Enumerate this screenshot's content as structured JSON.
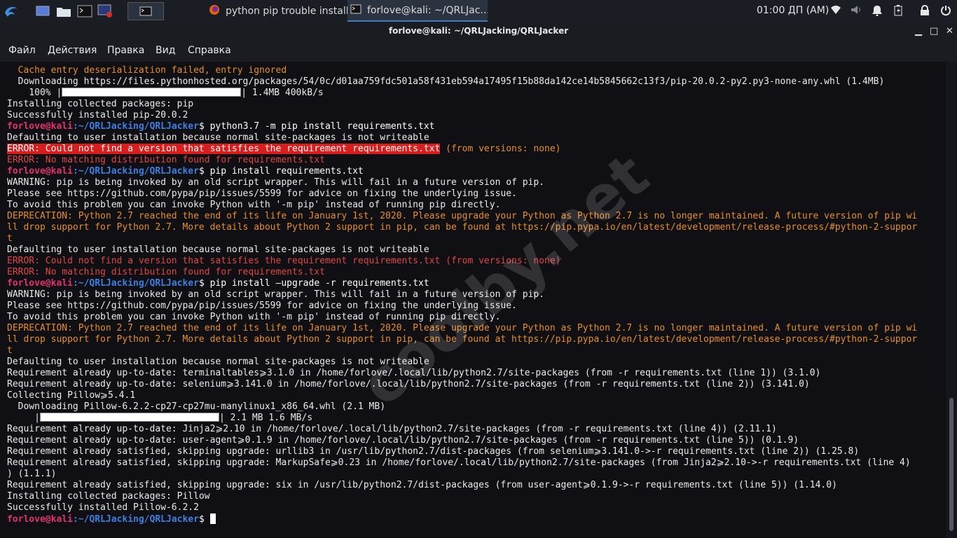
{
  "taskbar": {
    "tasks": [
      {
        "label": "python pip trouble install..."
      },
      {
        "label": "forlove@kali: ~/QRLJac..."
      }
    ],
    "clock": "01:00 ДП (AM)"
  },
  "window": {
    "title": "forlove@kali: ~/QRLJacking/QRLJacker"
  },
  "menu": [
    "Файл",
    "Действия",
    "Правка",
    "Вид",
    "Справка"
  ],
  "prompt": {
    "user": "forlove",
    "at": "@",
    "host": "kali",
    "path": ":~/QRLJacking/QRLJacker",
    "symbol": "$"
  },
  "terminal": {
    "lines": [
      {
        "type": "warn",
        "text": "  Cache entry deserialization failed, entry ignored"
      },
      {
        "type": "normal",
        "text": "  Downloading https://files.pythonhosted.org/packages/54/0c/d01aa759fdc501a58f431eb594a17495f15b88da142ce14b5845662c13f3/pip-20.0.2-py2.py3-none-any.whl (1.4MB)"
      },
      {
        "type": "progress",
        "prefix": "    100% |",
        "suffix": "| 1.4MB 400kB/s",
        "fill": 1.0
      },
      {
        "type": "normal",
        "text": "Installing collected packages: pip"
      },
      {
        "type": "normal",
        "text": "Successfully installed pip-20.0.2"
      },
      {
        "type": "prompt",
        "cmd": " python3.7 -m pip install requirements.txt"
      },
      {
        "type": "normal",
        "text": "Defaulting to user installation because normal site-packages is not writeable"
      },
      {
        "type": "errhl",
        "hl": "ERROR: Could not find a version that satisfies the requirement requirements.txt",
        "rest": " (from versions: none)"
      },
      {
        "type": "err",
        "text": "ERROR: No matching distribution found for requirements.txt"
      },
      {
        "type": "prompt",
        "cmd": " pip install requirements.txt"
      },
      {
        "type": "normal",
        "text": "WARNING: pip is being invoked by an old script wrapper. This will fail in a future version of pip."
      },
      {
        "type": "normal",
        "text": "Please see https://github.com/pypa/pip/issues/5599 for advice on fixing the underlying issue."
      },
      {
        "type": "normal",
        "text": "To avoid this problem you can invoke Python with '-m pip' instead of running pip directly."
      },
      {
        "type": "warn",
        "text": "DEPRECATION: Python 2.7 reached the end of its life on January 1st, 2020. Please upgrade your Python as Python 2.7 is no longer maintained. A future version of pip wi"
      },
      {
        "type": "warn",
        "text": "ll drop support for Python 2.7. More details about Python 2 support in pip, can be found at https://pip.pypa.io/en/latest/development/release-process/#python-2-suppor"
      },
      {
        "type": "warn",
        "text": "t"
      },
      {
        "type": "normal",
        "text": "Defaulting to user installation because normal site-packages is not writeable"
      },
      {
        "type": "err",
        "text": "ERROR: Could not find a version that satisfies the requirement requirements.txt (from versions: none)"
      },
      {
        "type": "err",
        "text": "ERROR: No matching distribution found for requirements.txt"
      },
      {
        "type": "prompt",
        "cmd": " pip install —upgrade -r requirements.txt"
      },
      {
        "type": "normal",
        "text": "WARNING: pip is being invoked by an old script wrapper. This will fail in a future version of pip."
      },
      {
        "type": "normal",
        "text": "Please see https://github.com/pypa/pip/issues/5599 for advice on fixing the underlying issue."
      },
      {
        "type": "normal",
        "text": "To avoid this problem you can invoke Python with '-m pip' instead of running pip directly."
      },
      {
        "type": "warn",
        "text": "DEPRECATION: Python 2.7 reached the end of its life on January 1st, 2020. Please upgrade your Python as Python 2.7 is no longer maintained. A future version of pip wi"
      },
      {
        "type": "warn",
        "text": "ll drop support for Python 2.7. More details about Python 2 support in pip, can be found at https://pip.pypa.io/en/latest/development/release-process/#python-2-suppor"
      },
      {
        "type": "warn",
        "text": "t"
      },
      {
        "type": "normal",
        "text": "Defaulting to user installation because normal site-packages is not writeable"
      },
      {
        "type": "normal",
        "text": "Requirement already up-to-date: terminaltables⩾3.1.0 in /home/forlove/.local/lib/python2.7/site-packages (from -r requirements.txt (line 1)) (3.1.0)"
      },
      {
        "type": "normal",
        "text": "Requirement already up-to-date: selenium⩾3.141.0 in /home/forlove/.local/lib/python2.7/site-packages (from -r requirements.txt (line 2)) (3.141.0)"
      },
      {
        "type": "normal",
        "text": "Collecting Pillow⩾5.4.1"
      },
      {
        "type": "normal",
        "text": "  Downloading Pillow-6.2.2-cp27-cp27mu-manylinux1_x86_64.whl (2.1 MB)"
      },
      {
        "type": "progress",
        "prefix": "     |",
        "suffix": "| 2.1 MB 1.6 MB/s",
        "fill": 1.0
      },
      {
        "type": "normal",
        "text": "Requirement already up-to-date: Jinja2⩾2.10 in /home/forlove/.local/lib/python2.7/site-packages (from -r requirements.txt (line 4)) (2.11.1)"
      },
      {
        "type": "normal",
        "text": "Requirement already up-to-date: user-agent⩾0.1.9 in /home/forlove/.local/lib/python2.7/site-packages (from -r requirements.txt (line 5)) (0.1.9)"
      },
      {
        "type": "normal",
        "text": "Requirement already satisfied, skipping upgrade: urllib3 in /usr/lib/python2.7/dist-packages (from selenium⩾3.141.0->-r requirements.txt (line 2)) (1.25.8)"
      },
      {
        "type": "normal",
        "text": "Requirement already satisfied, skipping upgrade: MarkupSafe⩾0.23 in /home/forlove/.local/lib/python2.7/site-packages (from Jinja2⩾2.10->-r requirements.txt (line 4)"
      },
      {
        "type": "normal",
        "text": ") (1.1.1)"
      },
      {
        "type": "normal",
        "text": "Requirement already satisfied, skipping upgrade: six in /usr/lib/python2.7/dist-packages (from user-agent⩾0.1.9->-r requirements.txt (line 5)) (1.14.0)"
      },
      {
        "type": "normal",
        "text": "Installing collected packages: Pillow"
      },
      {
        "type": "normal",
        "text": "Successfully installed Pillow-6.2.2"
      },
      {
        "type": "prompt",
        "cmd": " ",
        "cursor": true
      }
    ]
  },
  "watermark": "coolby.net",
  "colors": {
    "warn": "#e58e2c",
    "error": "#e04646",
    "error_highlight": "#d81d1d",
    "prompt_user": "#e0346c",
    "prompt_path": "#3f7fe0",
    "background": "#101014"
  }
}
